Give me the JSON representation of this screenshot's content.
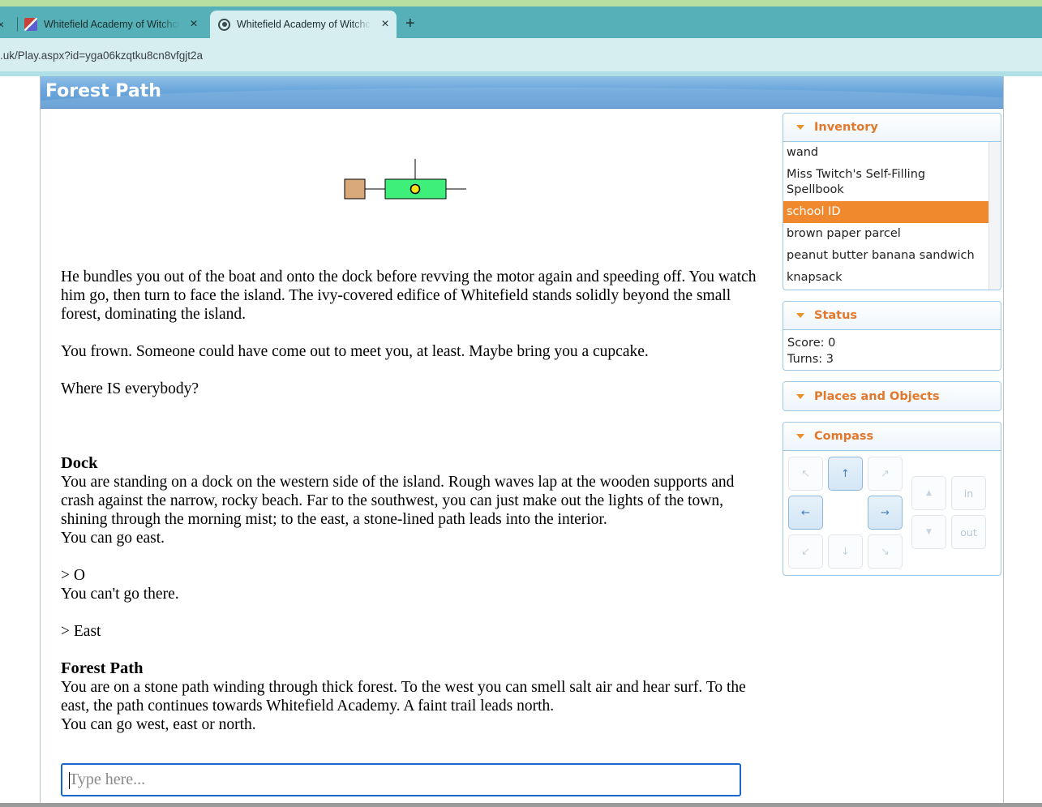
{
  "browser": {
    "tabs": [
      {
        "title": "Whitefield Academy of Witchcraft",
        "active": false
      },
      {
        "title": "Whitefield Academy of Witchcraft",
        "active": true
      }
    ],
    "new_tab_symbol": "+",
    "close_symbol": "×",
    "address": ".uk/Play.aspx?id=yga06kzqtku8cn8vfgjt2a"
  },
  "game": {
    "location_title": "Forest Path",
    "story": {
      "intro_1": "He bundles you out of the boat and onto the dock before revving the motor again and speeding off. You watch him go, then turn to face the island. The ivy-covered edifice of Whitefield stands solidly beyond the small forest, dominating the island.",
      "intro_2": "You frown. Someone could have come out to meet you, at least. Maybe bring you a cupcake.",
      "intro_3": "Where IS everybody?",
      "dock_title": "Dock",
      "dock_desc": "You are standing on a dock on the western side of the island. Rough waves lap at the wooden supports and crash against the narrow, rocky beach. Far to the southwest, you can just make out the lights of the town, shining through the morning mist; to the east, a stone-lined path leads into the interior.",
      "dock_exits": "You can go east.",
      "cmd_1": "> O",
      "resp_1": "You can't go there.",
      "cmd_2": "> East",
      "path_title": "Forest Path",
      "path_desc": "You are on a stone path winding through thick forest. To the west you can smell salt air and hear surf. To the east, the path continues towards Whitefield Academy. A faint trail leads north.",
      "path_exits": "You can go west, east or north."
    },
    "command_placeholder": "Type here...",
    "map": {
      "rooms": [
        {
          "label": "",
          "color": "#d9a97a",
          "current": false
        },
        {
          "label": "",
          "color": "#3ef07a",
          "current": true
        }
      ],
      "player_marker_color": "#f7e51a"
    }
  },
  "sidebar": {
    "inventory": {
      "heading": "Inventory",
      "items": [
        {
          "label": "wand"
        },
        {
          "label": "Miss Twitch's Self-Filling Spellbook"
        },
        {
          "label": "school ID"
        },
        {
          "label": "brown paper parcel"
        },
        {
          "label": "peanut butter banana sandwich"
        },
        {
          "label": "knapsack"
        }
      ],
      "selected_item": "school ID"
    },
    "status": {
      "heading": "Status",
      "score": "Score: 0",
      "turns": "Turns: 3"
    },
    "places": {
      "heading": "Places and Objects"
    },
    "compass": {
      "heading": "Compass",
      "buttons": {
        "nw": "↖",
        "n": "↑",
        "ne": "↗",
        "w": "←",
        "e": "→",
        "sw": "↙",
        "s": "↓",
        "se": "↘",
        "up": "▲",
        "down": "▼",
        "in": "in",
        "out": "out"
      },
      "enabled": [
        "n",
        "w",
        "e"
      ]
    }
  }
}
